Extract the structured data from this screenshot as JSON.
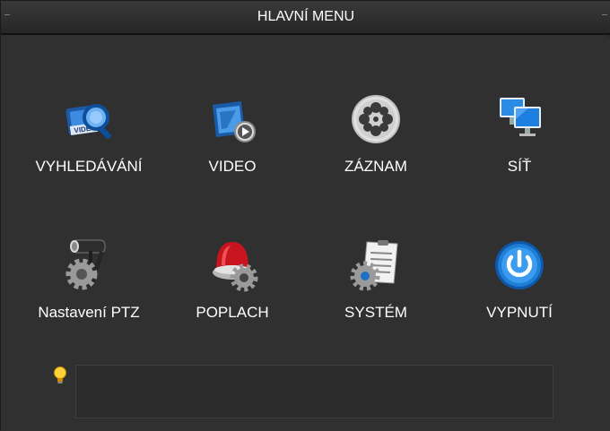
{
  "header": {
    "title": "HLAVNÍ MENU"
  },
  "menu": {
    "items": [
      {
        "label": "VYHLEDÁVÁNÍ",
        "icon": "video-search-icon",
        "badge": "VIDEO"
      },
      {
        "label": "VIDEO",
        "icon": "video-player-icon"
      },
      {
        "label": "ZÁZNAM",
        "icon": "film-reel-icon"
      },
      {
        "label": "SÍŤ",
        "icon": "network-monitors-icon"
      },
      {
        "label": "Nastavení PTZ",
        "icon": "ptz-camera-gear-icon"
      },
      {
        "label": "POPLACH",
        "icon": "alarm-siren-gear-icon"
      },
      {
        "label": "SYSTÉM",
        "icon": "document-gear-icon"
      },
      {
        "label": "VYPNUTÍ",
        "icon": "power-icon"
      }
    ]
  },
  "hint": {
    "icon": "lightbulb-icon",
    "text": ""
  },
  "colors": {
    "background": "#303030",
    "titlebar": "#2a2a2a",
    "text": "#ffffff",
    "accent_blue": "#1f7fd6"
  }
}
